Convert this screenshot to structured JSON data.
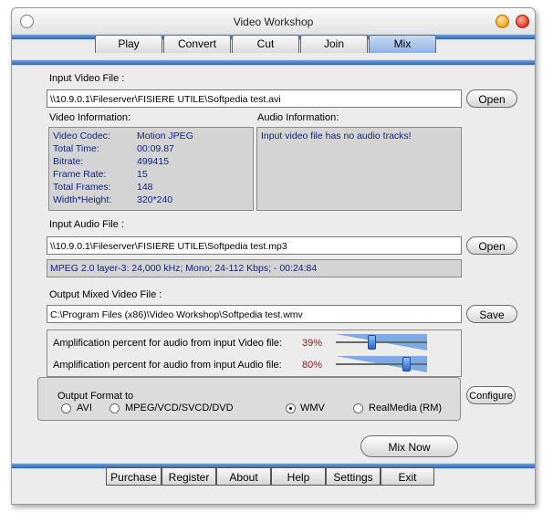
{
  "window": {
    "title": "Video Workshop"
  },
  "tabs": [
    {
      "label": "Play"
    },
    {
      "label": "Convert"
    },
    {
      "label": "Cut"
    },
    {
      "label": "Join"
    },
    {
      "label": "Mix"
    }
  ],
  "active_tab": "Mix",
  "input_video": {
    "label": "Input Video File :",
    "value": "\\\\10.9.0.1\\Fileserver\\FISIERE UTILE\\Softpedia test.avi",
    "open_label": "Open"
  },
  "video_info": {
    "label": "Video Information:",
    "rows": [
      {
        "k": "Video Codec:",
        "v": "Motion JPEG"
      },
      {
        "k": "Total Time:",
        "v": "00:09.87"
      },
      {
        "k": "Bitrate:",
        "v": "499415"
      },
      {
        "k": "Frame Rate:",
        "v": "15"
      },
      {
        "k": "Total Frames:",
        "v": "148"
      },
      {
        "k": "Width*Height:",
        "v": "320*240"
      }
    ]
  },
  "audio_info": {
    "label": "Audio Information:",
    "text": "Input video file has no audio tracks!"
  },
  "input_audio": {
    "label": "Input Audio File :",
    "value": "\\\\10.9.0.1\\Fileserver\\FISIERE UTILE\\Softpedia test.mp3",
    "open_label": "Open",
    "details": "MPEG 2.0 layer-3: 24,000 kHz; Mono; 24-112 Kbps;   -  00:24:84"
  },
  "output": {
    "label": "Output Mixed Video File :",
    "value": "C:\\Program Files (x86)\\Video Workshop\\Softpedia test.wmv",
    "save_label": "Save"
  },
  "amplification": {
    "video_label": "Amplification percent for audio from input Video file:",
    "video_pct": "39%",
    "video_level": 0.39,
    "audio_label": "Amplification percent for audio from input Audio file:",
    "audio_pct": "80%",
    "audio_level": 0.8
  },
  "format": {
    "group_label": "Output Format to",
    "configure_label": "Configure",
    "options": [
      {
        "label": "AVI",
        "selected": false
      },
      {
        "label": "MPEG/VCD/SVCD/DVD",
        "selected": false
      },
      {
        "label": "WMV",
        "selected": true
      },
      {
        "label": "RealMedia (RM)",
        "selected": false
      }
    ]
  },
  "mix_now_label": "Mix Now",
  "bottom_buttons": [
    {
      "label": "Purchase"
    },
    {
      "label": "Register"
    },
    {
      "label": "About"
    },
    {
      "label": "Help"
    },
    {
      "label": "Settings"
    },
    {
      "label": "Exit"
    }
  ],
  "colors": {
    "accent": "#2e63b2",
    "info_text": "#11237d",
    "percent_text": "#8b1a1a"
  }
}
